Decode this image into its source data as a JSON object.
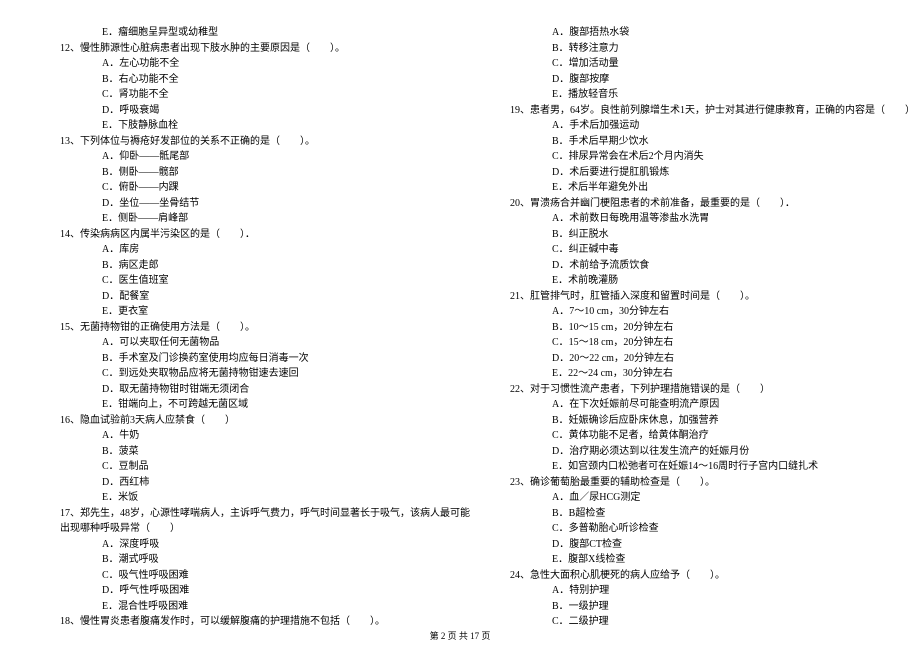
{
  "left_column": [
    {
      "cls": "option",
      "text": "E．瘤细胞呈异型或幼稚型"
    },
    {
      "cls": "question",
      "text": "12、慢性肺源性心脏病患者出现下肢水肿的主要原因是（　　）。"
    },
    {
      "cls": "option",
      "text": "A．左心功能不全"
    },
    {
      "cls": "option",
      "text": "B．右心功能不全"
    },
    {
      "cls": "option",
      "text": "C．肾功能不全"
    },
    {
      "cls": "option",
      "text": "D．呼吸衰竭"
    },
    {
      "cls": "option",
      "text": "E．下肢静脉血栓"
    },
    {
      "cls": "question",
      "text": "13、下列体位与褥疮好发部位的关系不正确的是（　　）。"
    },
    {
      "cls": "option",
      "text": "A．仰卧——骶尾部"
    },
    {
      "cls": "option",
      "text": "B．侧卧——髋部"
    },
    {
      "cls": "option",
      "text": "C．俯卧——内踝"
    },
    {
      "cls": "option",
      "text": "D．坐位——坐骨结节"
    },
    {
      "cls": "option",
      "text": "E．侧卧——肩峰部"
    },
    {
      "cls": "question",
      "text": "14、传染病病区内属半污染区的是（　　）．"
    },
    {
      "cls": "option",
      "text": "A．库房"
    },
    {
      "cls": "option",
      "text": "B．病区走郎"
    },
    {
      "cls": "option",
      "text": "C．医生值班室"
    },
    {
      "cls": "option",
      "text": "D．配餐室"
    },
    {
      "cls": "option",
      "text": "E．更衣室"
    },
    {
      "cls": "question",
      "text": "15、无菌持物钳的正确使用方法是（　　）。"
    },
    {
      "cls": "option",
      "text": "A．可以夹取任何无菌物品"
    },
    {
      "cls": "option",
      "text": "B．手术室及门诊换药室使用均应每日消毒一次"
    },
    {
      "cls": "option",
      "text": "C．到远处夹取物品应将无菌持物钳速去速回"
    },
    {
      "cls": "option",
      "text": "D．取无菌持物钳时钳端无须闭合"
    },
    {
      "cls": "option",
      "text": "E．钳端向上，不可跨越无菌区域"
    },
    {
      "cls": "question",
      "text": "16、隐血试验前3天病人应禁食（　　）"
    },
    {
      "cls": "option",
      "text": "A．牛奶"
    },
    {
      "cls": "option",
      "text": "B．菠菜"
    },
    {
      "cls": "option",
      "text": "C．豆制品"
    },
    {
      "cls": "option",
      "text": "D．西红柿"
    },
    {
      "cls": "option",
      "text": "E．米饭"
    },
    {
      "cls": "question",
      "text": "17、郑先生，48岁，心源性哮喘病人，主诉呼气费力，呼气时间显著长于吸气，该病人最可能"
    },
    {
      "cls": "question",
      "text": "出现哪种呼吸异常（　　）"
    },
    {
      "cls": "option",
      "text": "A．深度呼吸"
    },
    {
      "cls": "option",
      "text": "B．潮式呼吸"
    },
    {
      "cls": "option",
      "text": "C．吸气性呼吸困难"
    },
    {
      "cls": "option",
      "text": "D．呼气性呼吸困难"
    },
    {
      "cls": "option",
      "text": "E．混合性呼吸困难"
    },
    {
      "cls": "question",
      "text": "18、慢性胃炎患者腹痛发作时，可以缓解腹痛的护理措施不包括（　　）。"
    }
  ],
  "right_column": [
    {
      "cls": "option",
      "text": "A．腹部捂热水袋"
    },
    {
      "cls": "option",
      "text": "B．转移注意力"
    },
    {
      "cls": "option",
      "text": "C．增加活动量"
    },
    {
      "cls": "option",
      "text": "D．腹部按摩"
    },
    {
      "cls": "option",
      "text": "E．播放轻音乐"
    },
    {
      "cls": "question",
      "text": "19、患者男，64岁。良性前列腺增生术1天，护士对其进行健康教育，正确的内容是（　　）"
    },
    {
      "cls": "option",
      "text": "A．手术后加强运动"
    },
    {
      "cls": "option",
      "text": "B．手术后早期少饮水"
    },
    {
      "cls": "option",
      "text": "C．排尿异常会在术后2个月内消失"
    },
    {
      "cls": "option",
      "text": "D．术后要进行提肛肌锻炼"
    },
    {
      "cls": "option",
      "text": "E．术后半年避免外出"
    },
    {
      "cls": "question",
      "text": "20、胃溃疡合并幽门梗阻患者的术前准备，最重要的是（　　）．"
    },
    {
      "cls": "option",
      "text": "A．术前数日每晚用温等渗盐水洗胃"
    },
    {
      "cls": "option",
      "text": "B．纠正脱水"
    },
    {
      "cls": "option",
      "text": "C．纠正碱中毒"
    },
    {
      "cls": "option",
      "text": "D．术前给予流质饮食"
    },
    {
      "cls": "option",
      "text": "E．术前晚灌肠"
    },
    {
      "cls": "question",
      "text": "21、肛管排气时，肛管插入深度和留置时间是（　　）。"
    },
    {
      "cls": "option",
      "text": "A．7～10 cm，30分钟左右"
    },
    {
      "cls": "option",
      "text": "B．10～15 cm，20分钟左右"
    },
    {
      "cls": "option",
      "text": "C．15～18 cm，20分钟左右"
    },
    {
      "cls": "option",
      "text": "D．20～22 cm，20分钟左右"
    },
    {
      "cls": "option",
      "text": "E．22～24 cm，30分钟左右"
    },
    {
      "cls": "question",
      "text": "22、对于习惯性流产患者，下列护理措施错误的是（　　）"
    },
    {
      "cls": "option",
      "text": "A．在下次妊娠前尽可能查明流产原因"
    },
    {
      "cls": "option",
      "text": "B．妊娠确诊后应卧床休息，加强营养"
    },
    {
      "cls": "option",
      "text": "C．黄体功能不足者，给黄体酮治疗"
    },
    {
      "cls": "option",
      "text": "D．治疗期必须达到以往发生流产的妊娠月份"
    },
    {
      "cls": "option",
      "text": "E．如宫颈内口松弛者可在妊娠14～16周时行子宫内口缝扎术"
    },
    {
      "cls": "question",
      "text": "23、确诊葡萄胎最重要的辅助检查是（　　）。"
    },
    {
      "cls": "option",
      "text": "A．血／尿HCG测定"
    },
    {
      "cls": "option",
      "text": "B．B超检查"
    },
    {
      "cls": "option",
      "text": "C．多普勒胎心听诊检查"
    },
    {
      "cls": "option",
      "text": "D．腹部CT检查"
    },
    {
      "cls": "option",
      "text": "E．腹部X线检查"
    },
    {
      "cls": "question",
      "text": "24、急性大面积心肌梗死的病人应给予（　　）。"
    },
    {
      "cls": "option",
      "text": "A．特别护理"
    },
    {
      "cls": "option",
      "text": "B．一级护理"
    },
    {
      "cls": "option",
      "text": "C．二级护理"
    }
  ],
  "footer": "第 2 页 共 17 页"
}
